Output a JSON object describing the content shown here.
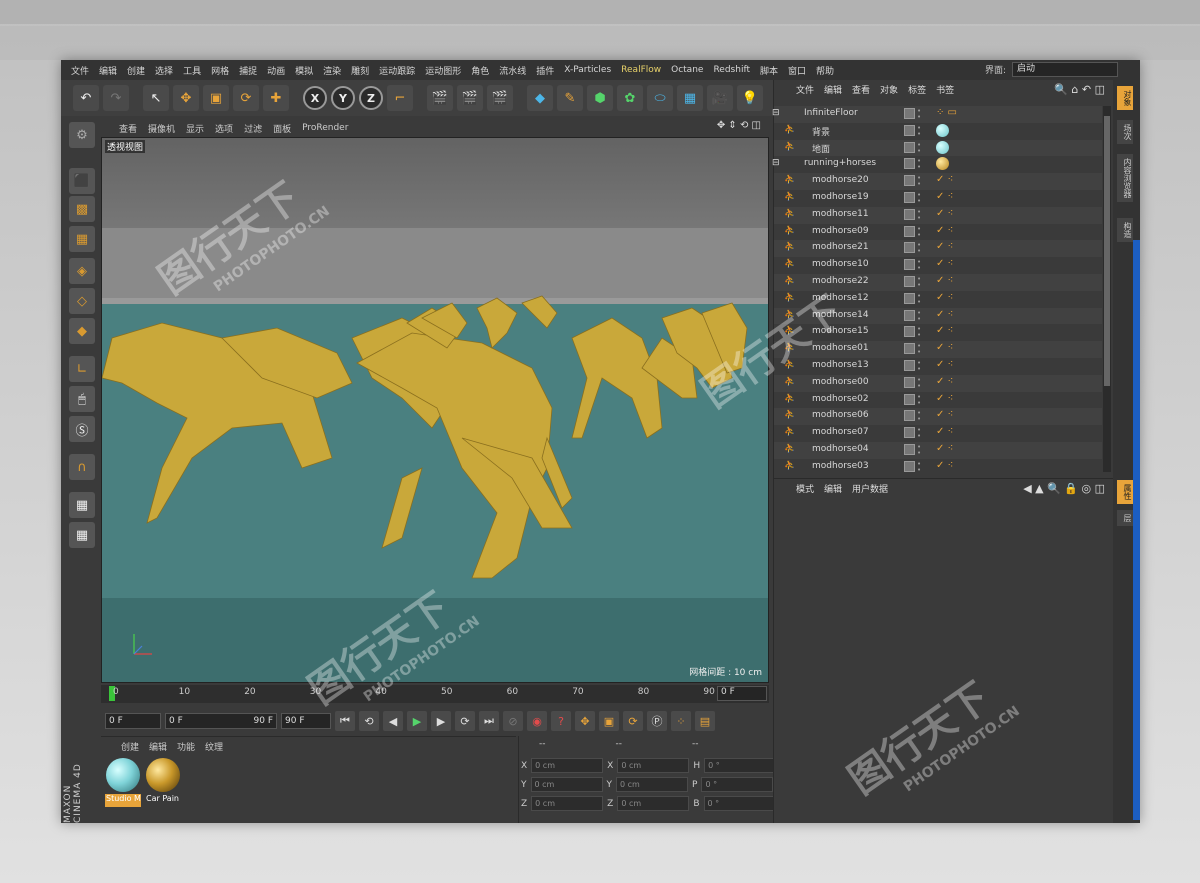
{
  "menubar": {
    "items": [
      "文件",
      "编辑",
      "创建",
      "选择",
      "工具",
      "网格",
      "捕捉",
      "动画",
      "模拟",
      "渲染",
      "雕刻",
      "运动跟踪",
      "运动图形",
      "角色",
      "流水线",
      "插件",
      "X-Particles",
      "RealFlow",
      "Octane",
      "Redshift",
      "脚本",
      "窗口",
      "帮助"
    ],
    "layout_label": "界面:",
    "layout_value": "启动"
  },
  "viewport": {
    "tabs": [
      "查看",
      "摄像机",
      "显示",
      "选项",
      "过滤",
      "面板",
      "ProRender"
    ],
    "label": "透视视图",
    "grid_spacing": "网格间距 : 10 cm"
  },
  "timeline": {
    "ticks": [
      "0",
      "10",
      "20",
      "30",
      "40",
      "50",
      "60",
      "70",
      "80",
      "90"
    ],
    "end_field": "0 F"
  },
  "transport": {
    "current_frame": "0 F",
    "range_start": "0 F",
    "range_end": "90 F",
    "max_frame": "90 F"
  },
  "materials": {
    "tabs": [
      "创建",
      "编辑",
      "功能",
      "纹理"
    ],
    "items": [
      {
        "name": "Studio M",
        "color": "#7fd3d8"
      },
      {
        "name": "Car Pain",
        "color": "#c9982a"
      }
    ]
  },
  "coords": {
    "header": [
      "--",
      "--",
      "--"
    ],
    "rows": [
      {
        "a": "X",
        "av": "0 cm",
        "b": "X",
        "bv": "0 cm",
        "c": "H",
        "cv": "0 °"
      },
      {
        "a": "Y",
        "av": "0 cm",
        "b": "Y",
        "bv": "0 cm",
        "c": "P",
        "cv": "0 °"
      },
      {
        "a": "Z",
        "av": "0 cm",
        "b": "Z",
        "bv": "0 cm",
        "c": "B",
        "cv": "0 °"
      }
    ]
  },
  "objects": {
    "menu": [
      "文件",
      "编辑",
      "查看",
      "对象",
      "标签",
      "书签"
    ],
    "rows": [
      {
        "name": "InfiniteFloor",
        "indent": 0,
        "tag": "floor"
      },
      {
        "name": "背景",
        "indent": 1,
        "tag": "ball-cyan"
      },
      {
        "name": "地面",
        "indent": 1,
        "tag": "ball-cyan"
      },
      {
        "name": "running+horses",
        "indent": 0,
        "tag": "ball-gold"
      },
      {
        "name": "modhorse20",
        "indent": 1,
        "tag": "bones"
      },
      {
        "name": "modhorse19",
        "indent": 1,
        "tag": "bones"
      },
      {
        "name": "modhorse11",
        "indent": 1,
        "tag": "bones"
      },
      {
        "name": "modhorse09",
        "indent": 1,
        "tag": "bones"
      },
      {
        "name": "modhorse21",
        "indent": 1,
        "tag": "bones"
      },
      {
        "name": "modhorse10",
        "indent": 1,
        "tag": "bones"
      },
      {
        "name": "modhorse22",
        "indent": 1,
        "tag": "bones"
      },
      {
        "name": "modhorse12",
        "indent": 1,
        "tag": "bones"
      },
      {
        "name": "modhorse14",
        "indent": 1,
        "tag": "bones"
      },
      {
        "name": "modhorse15",
        "indent": 1,
        "tag": "bones"
      },
      {
        "name": "modhorse01",
        "indent": 1,
        "tag": "bones"
      },
      {
        "name": "modhorse13",
        "indent": 1,
        "tag": "bones"
      },
      {
        "name": "modhorse00",
        "indent": 1,
        "tag": "bones"
      },
      {
        "name": "modhorse02",
        "indent": 1,
        "tag": "bones"
      },
      {
        "name": "modhorse06",
        "indent": 1,
        "tag": "bones"
      },
      {
        "name": "modhorse07",
        "indent": 1,
        "tag": "bones"
      },
      {
        "name": "modhorse04",
        "indent": 1,
        "tag": "bones"
      },
      {
        "name": "modhorse03",
        "indent": 1,
        "tag": "bones"
      }
    ]
  },
  "attributes": {
    "menu": [
      "模式",
      "编辑",
      "用户数据"
    ]
  },
  "side_tabs": [
    "对象",
    "场次",
    "内容浏览器",
    "构造",
    "属性",
    "层"
  ],
  "watermark": {
    "cn": "图行天下",
    "en": "PHOTOPHOTO.CN"
  },
  "brand": "MAXON CINEMA 4D",
  "colors": {
    "accent": "#e8a43a",
    "viewport_floor": "#4a8080",
    "horse": "#c9a83a"
  }
}
